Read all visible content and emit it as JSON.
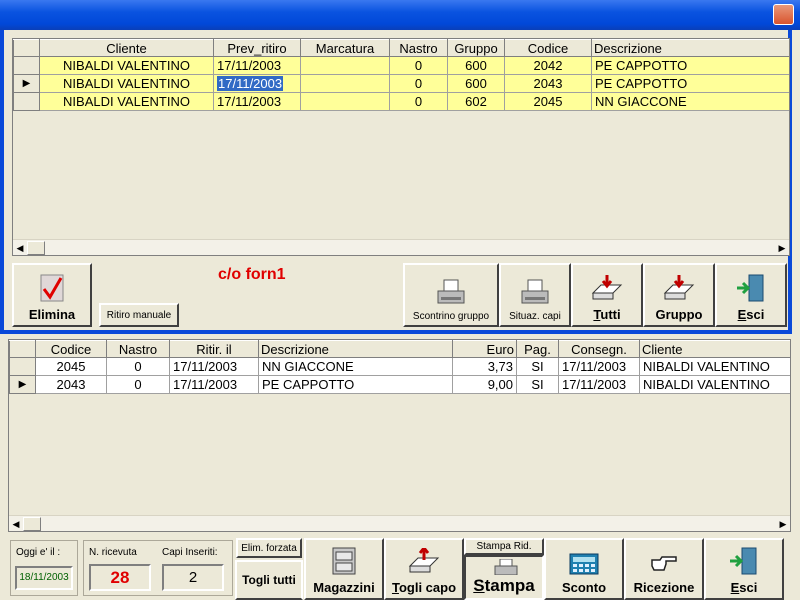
{
  "top_grid": {
    "columns": [
      "Cliente",
      "Prev_ritiro",
      "Marcatura",
      "Nastro",
      "Gruppo",
      "Codice",
      "Descrizione"
    ],
    "rows": [
      {
        "cliente": "NIBALDI VALENTINO",
        "prev_ritiro": "17/11/2003",
        "marcatura": "",
        "nastro": "0",
        "gruppo": "600",
        "codice": "2042",
        "descrizione": "PE CAPPOTTO"
      },
      {
        "cliente": "NIBALDI VALENTINO",
        "prev_ritiro": "17/11/2003",
        "marcatura": "",
        "nastro": "0",
        "gruppo": "600",
        "codice": "2043",
        "descrizione": "PE CAPPOTTO"
      },
      {
        "cliente": "NIBALDI VALENTINO",
        "prev_ritiro": "17/11/2003",
        "marcatura": "",
        "nastro": "0",
        "gruppo": "602",
        "codice": "2045",
        "descrizione": "NN GIACCONE"
      }
    ]
  },
  "toolbar": {
    "elimina": "Elimina",
    "ritiro_manuale": "Ritiro manuale",
    "info_label": "c/o forn1",
    "scontrino_gruppo": "Scontrino gruppo",
    "situaz_capi": "Situaz. capi",
    "tutti_u": "T",
    "tutti_rest": "utti",
    "gruppo": "Gruppo",
    "esci_u": "E",
    "esci_rest": "sci"
  },
  "bottom_grid": {
    "columns": [
      "Codice",
      "Nastro",
      "Ritir. il",
      "Descrizione",
      "Euro",
      "Pag.",
      "Consegn.",
      "Cliente"
    ],
    "rows": [
      {
        "codice": "2045",
        "nastro": "0",
        "ritir": "17/11/2003",
        "descrizione": "NN GIACCONE",
        "euro": "3,73",
        "pag": "SI",
        "consegn": "17/11/2003",
        "cliente": "NIBALDI VALENTINO"
      },
      {
        "codice": "2043",
        "nastro": "0",
        "ritir": "17/11/2003",
        "descrizione": "PE CAPPOTTO",
        "euro": "9,00",
        "pag": "SI",
        "consegn": "17/11/2003",
        "cliente": "NIBALDI VALENTINO"
      }
    ]
  },
  "status": {
    "oggi_label": "Oggi e' il :",
    "oggi_value": "18/11/2003",
    "ricevuta_label": "N. ricevuta",
    "ricevuta_value": "28",
    "capi_label": "Capi Inseriti:",
    "capi_value": "2"
  },
  "bottom_toolbar": {
    "elim_forzata": "Elim. forzata",
    "togli_tutti": "Togli tutti",
    "magazzini": "Magazzini",
    "togli_capo_u": "T",
    "togli_capo_rest": "ogli capo",
    "stampa_rid": "Stampa Rid.",
    "stampa_u": "S",
    "stampa_rest": "tampa",
    "sconto": "Sconto",
    "ricezione": "Ricezione",
    "esci_u": "E",
    "esci_rest": "sci"
  },
  "colors": {
    "row_highlight": "#ffff99",
    "selection": "#316ac5",
    "title_blue": "#0a49d9",
    "red_text": "#e00000"
  }
}
